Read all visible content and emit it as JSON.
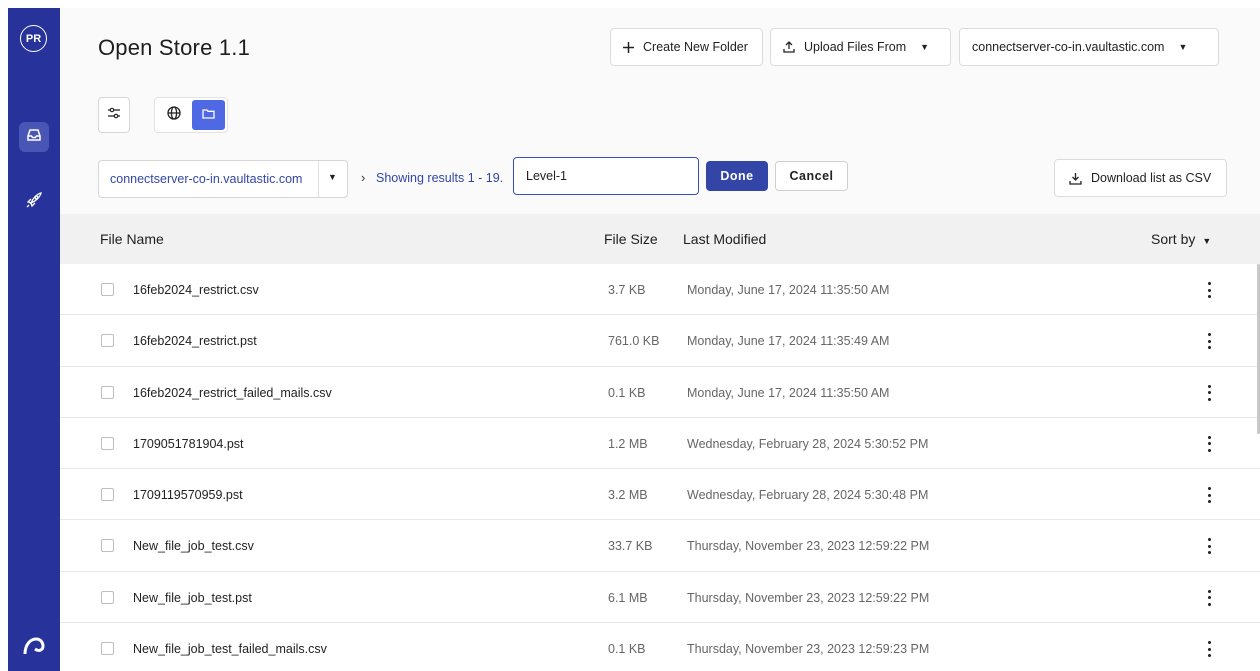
{
  "sidebar": {
    "avatar_initials": "PR",
    "items": [
      {
        "icon": "inbox-icon",
        "active": true
      },
      {
        "icon": "rocket-icon",
        "active": false
      }
    ],
    "logo_icon": "brand-logo-icon"
  },
  "header": {
    "title": "Open Store 1.1",
    "create_folder_label": "Create New Folder",
    "upload_label": "Upload Files From",
    "server_selector": "connectserver-co-in.vaultastic.com"
  },
  "toolbar": {
    "host_select": "connectserver-co-in.vaultastic.com",
    "results_text": "Showing results 1 - 19.",
    "folder_name_value": "Level-1",
    "done_label": "Done",
    "cancel_label": "Cancel",
    "download_csv_label": "Download list as CSV"
  },
  "table": {
    "columns": {
      "name": "File Name",
      "size": "File Size",
      "modified": "Last Modified",
      "sort": "Sort by"
    },
    "rows": [
      {
        "name": "16feb2024_restrict.csv",
        "size": "3.7 KB",
        "modified": "Monday, June 17, 2024 11:35:50 AM"
      },
      {
        "name": "16feb2024_restrict.pst",
        "size": "761.0 KB",
        "modified": "Monday, June 17, 2024 11:35:49 AM"
      },
      {
        "name": "16feb2024_restrict_failed_mails.csv",
        "size": "0.1 KB",
        "modified": "Monday, June 17, 2024 11:35:50 AM"
      },
      {
        "name": "1709051781904.pst",
        "size": "1.2 MB",
        "modified": "Wednesday, February 28, 2024 5:30:52 PM"
      },
      {
        "name": "1709119570959.pst",
        "size": "3.2 MB",
        "modified": "Wednesday, February 28, 2024 5:30:48 PM"
      },
      {
        "name": "New_file_job_test.csv",
        "size": "33.7 KB",
        "modified": "Thursday, November 23, 2023 12:59:22 PM"
      },
      {
        "name": "New_file_job_test.pst",
        "size": "6.1 MB",
        "modified": "Thursday, November 23, 2023 12:59:22 PM"
      },
      {
        "name": "New_file_job_test_failed_mails.csv",
        "size": "0.1 KB",
        "modified": "Thursday, November 23, 2023 12:59:23 PM"
      }
    ]
  },
  "colors": {
    "sidebar_bg": "#27339b",
    "primary": "#3346a8",
    "toggle_active": "#4f68e3"
  }
}
